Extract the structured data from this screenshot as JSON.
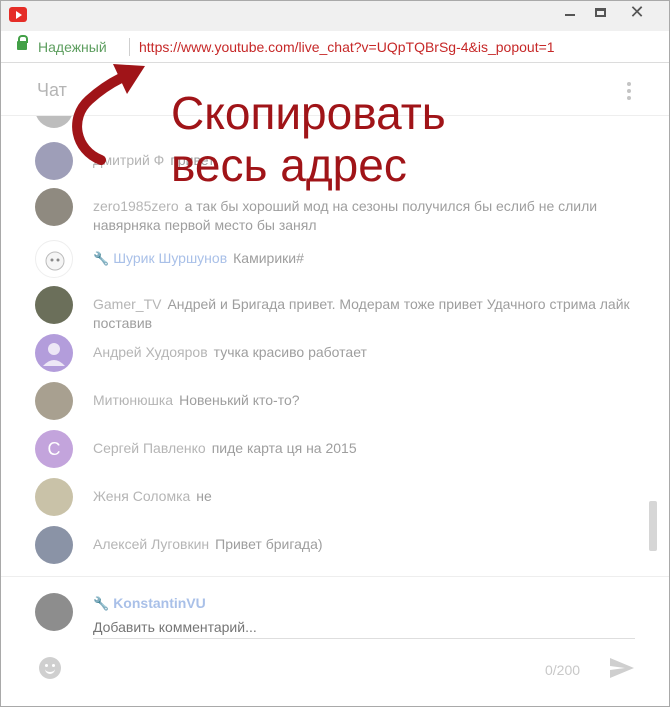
{
  "window": {
    "min_label": "",
    "max_label": "",
    "close_label": "✕"
  },
  "address": {
    "secure_label": "Надежный",
    "url": "https://www.youtube.com/live_chat?v=UQpTQBrSg-4&is_popout=1"
  },
  "header": {
    "title": "Чат"
  },
  "annotation": {
    "line1": "Скопировать",
    "line2": "весь адрес"
  },
  "messages": [
    {
      "author": "",
      "text": "",
      "mod": false
    },
    {
      "author": "Дмитрий Ф",
      "text": "привет",
      "mod": false
    },
    {
      "author": "zero1985zero",
      "text": "а так бы хороший мод на сезоны  получился бы еслиб не слили навярняка первой место бы занял",
      "mod": false
    },
    {
      "author": "Шурик Шуршунов",
      "text": "Камирики#",
      "mod": true
    },
    {
      "author": "Gamer_TV",
      "text": "Андрей и Бригада привет. Модерам тоже привет Удачного стрима лайк поставив",
      "mod": false
    },
    {
      "author": "Андрей Худояров",
      "text": "тучка красиво работает",
      "mod": false
    },
    {
      "author": "Митюнюшка",
      "text": "Новенький кто-то?",
      "mod": false
    },
    {
      "author": "Сергей Павленко",
      "text": "пиде карта ця на 2015",
      "mod": false,
      "avatar_letter": "C"
    },
    {
      "author": "Женя Соломка",
      "text": "не",
      "mod": false
    },
    {
      "author": "Алексей Луговкин",
      "text": "Привет бригада)",
      "mod": false
    }
  ],
  "composer": {
    "author": "KonstantinVU",
    "placeholder": "Добавить комментарий...",
    "char_count": "0/200"
  },
  "colors": {
    "annotation": "#a01418",
    "url": "#c62828",
    "moderator": "#a9c0e8"
  }
}
